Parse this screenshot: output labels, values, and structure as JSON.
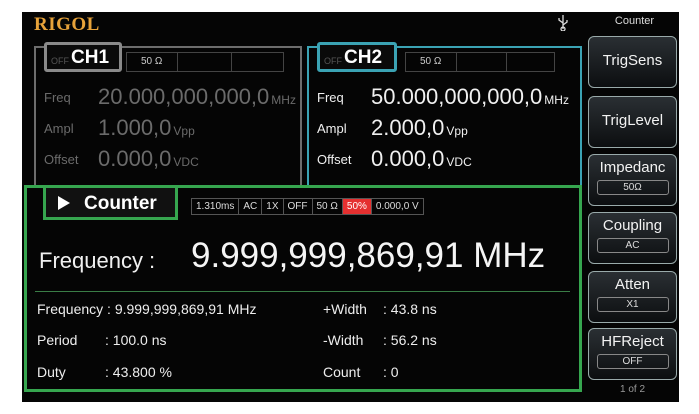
{
  "brand": "RIGOL",
  "status_icon": "usb-icon",
  "menu_title": "Counter",
  "ch1": {
    "name": "CH1",
    "state": "OFF",
    "impedance": "50 Ω",
    "params": [
      {
        "label": "Freq",
        "value": "20.000,000,000,0",
        "unit": "MHz"
      },
      {
        "label": "Ampl",
        "value": "1.000,0",
        "unit": "Vpp"
      },
      {
        "label": "Offset",
        "value": "0.000,0",
        "unit": "VDC"
      }
    ]
  },
  "ch2": {
    "name": "CH2",
    "state": "OFF",
    "impedance": "50 Ω",
    "params": [
      {
        "label": "Freq",
        "value": "50.000,000,000,0",
        "unit": "MHz"
      },
      {
        "label": "Ampl",
        "value": "2.000,0",
        "unit": "Vpp"
      },
      {
        "label": "Offset",
        "value": "0.000,0",
        "unit": "VDC"
      }
    ]
  },
  "counter": {
    "title": "Counter",
    "status": [
      "1.310ms",
      "AC",
      "1X",
      "OFF",
      "50 Ω",
      "50%",
      "0.000,0 V"
    ],
    "status_highlight_color": "#e53030",
    "big_label": "Frequency :",
    "big_value": "9.999,999,869,91 MHz",
    "measurements": {
      "frequency": "Frequency : 9.999,999,869,91 MHz",
      "period_label": "Period",
      "period_value": ":   100.0 ns",
      "duty_label": "Duty",
      "duty_value": ":   43.800 %",
      "pwidth_label": "+Width",
      "pwidth_value": ":    43.8 ns",
      "nwidth_label": "-Width",
      "nwidth_value": ":    56.2 ns",
      "count_label": "Count",
      "count_value": ":    0"
    }
  },
  "softkeys": [
    {
      "label": "TrigSens",
      "value": ""
    },
    {
      "label": "TrigLevel",
      "value": ""
    },
    {
      "label": "Impedanc",
      "value": "50Ω"
    },
    {
      "label": "Coupling",
      "value": "AC"
    },
    {
      "label": "Atten",
      "value": "X1"
    },
    {
      "label": "HFReject",
      "value": "OFF"
    }
  ],
  "page_indicator": "1 of 2",
  "colors": {
    "ch1": "#8a8a8a",
    "ch2": "#3ba3b4",
    "counter": "#36a64f",
    "brand": "#e8a33a"
  }
}
